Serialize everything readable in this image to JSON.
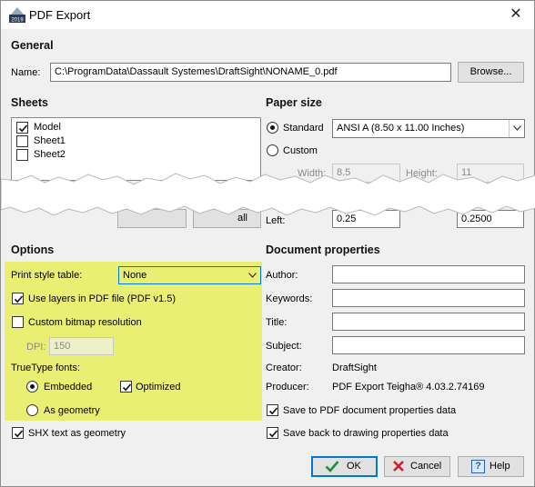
{
  "window": {
    "title": "PDF Export",
    "close_glyph": "✕"
  },
  "general": {
    "heading": "General",
    "name_label": "Name:",
    "name_value": "C:\\ProgramData\\Dassault Systemes\\DraftSight\\NONAME_0.pdf",
    "browse_label": "Browse..."
  },
  "sheets": {
    "heading": "Sheets",
    "items": [
      {
        "label": "Model",
        "checked": true
      },
      {
        "label": "Sheet1",
        "checked": false
      },
      {
        "label": "Sheet2",
        "checked": false
      }
    ],
    "button_fragment": "all"
  },
  "paper_size": {
    "heading": "Paper size",
    "standard_label": "Standard",
    "standard_value": "ANSI A (8.50 x 11.00 Inches)",
    "custom_label": "Custom",
    "width_label": "Width:",
    "width_value": "8.5",
    "height_label": "Height:",
    "height_value": "11",
    "left_label": "Left:",
    "left_value": "0.25",
    "right_margin_value": "0.2500"
  },
  "options": {
    "heading": "Options",
    "print_style_label": "Print style table:",
    "print_style_value": "None",
    "use_layers_label": "Use layers in PDF file (PDF v1.5)",
    "custom_bitmap_label": "Custom bitmap resolution",
    "dpi_label": "DPI:",
    "dpi_value": "150",
    "truetype_label": "TrueType fonts:",
    "embedded_label": "Embedded",
    "optimized_label": "Optimized",
    "as_geometry_label": "As geometry",
    "shx_label": "SHX text as geometry"
  },
  "doc_props": {
    "heading": "Document properties",
    "author_label": "Author:",
    "keywords_label": "Keywords:",
    "title_label": "Title:",
    "subject_label": "Subject:",
    "creator_label": "Creator:",
    "creator_value": "DraftSight",
    "producer_label": "Producer:",
    "producer_value": "PDF Export Teigha® 4.03.2.74169",
    "save_pdf_label": "Save to PDF document properties data",
    "save_back_label": "Save back to drawing properties data"
  },
  "buttons": {
    "ok": "OK",
    "cancel": "Cancel",
    "help": "Help"
  },
  "icons": {
    "app": "draftsight-app-icon",
    "close": "close-icon",
    "ok": "checkmark-icon",
    "cancel": "x-icon",
    "help": "help-icon"
  },
  "colors": {
    "highlight": "#e9ef72",
    "focus": "#0078d7",
    "ok_check": "#1b8f3a",
    "cancel_x": "#d0202a"
  }
}
